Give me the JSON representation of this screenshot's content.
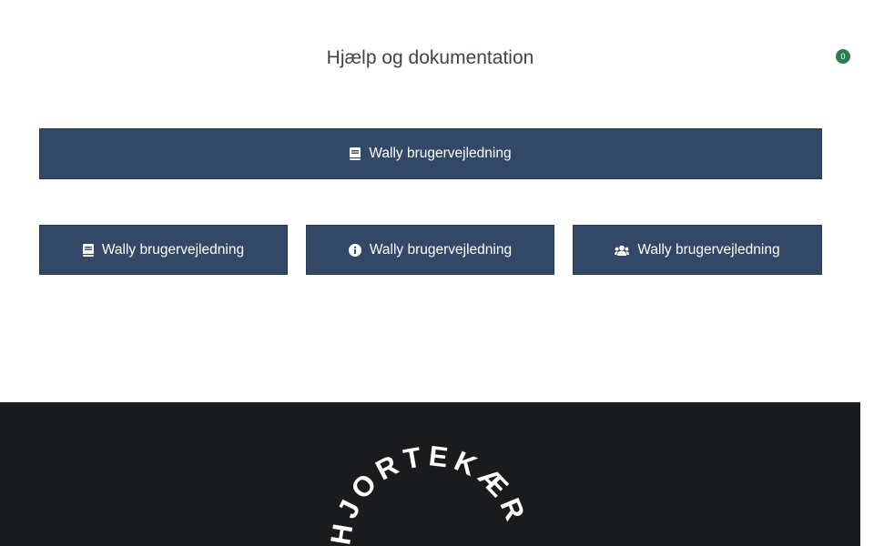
{
  "header": {
    "title": "Hjælp og dokumentation",
    "cart_count": "0"
  },
  "buttons": {
    "wide_label": "Wally brugervejledning",
    "row": [
      {
        "label": "Wally brugervejledning",
        "icon": "book-icon"
      },
      {
        "label": "Wally brugervejledning",
        "icon": "info-circle-icon"
      },
      {
        "label": "Wally brugervejledning",
        "icon": "users-icon"
      }
    ]
  },
  "footer": {
    "logo_text": "HJORTEKÆR"
  },
  "colors": {
    "button_bg": "#334866",
    "footer_bg": "#1a1b1c",
    "badge_bg": "#2e7d4f",
    "title_text": "#3c4451"
  }
}
